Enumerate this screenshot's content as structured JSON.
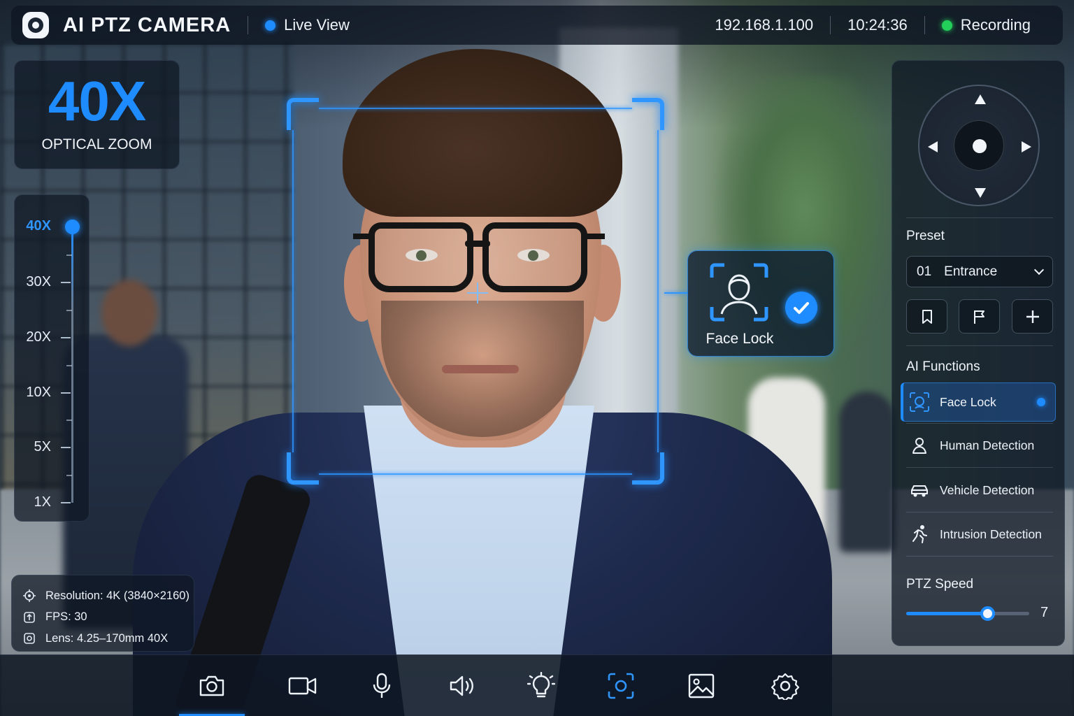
{
  "topbar": {
    "brand": "AI PTZ CAMERA",
    "live_view": "Live View",
    "ip": "192.168.1.100",
    "time": "10:24:36",
    "status": "Recording"
  },
  "zoom_card": {
    "value": "40X",
    "label": "OPTICAL ZOOM"
  },
  "zoom_scale": {
    "ticks": [
      "40X",
      "30X",
      "20X",
      "10X",
      "5X",
      "1X"
    ],
    "current": "40X"
  },
  "info": {
    "resolution": "Resolution: 4K (3840×2160)",
    "fps": "FPS: 30",
    "lens": "Lens: 4.25–170mm 40X"
  },
  "target": {
    "card_label": "Face Lock"
  },
  "right_panel": {
    "preset_title": "Preset",
    "preset_number": "01",
    "preset_name": "Entrance",
    "ai_title": "AI Functions",
    "ai_items": [
      {
        "label": "Face Lock",
        "icon": "face-scan-icon",
        "active": true
      },
      {
        "label": "Human Detection",
        "icon": "person-icon",
        "active": false
      },
      {
        "label": "Vehicle Detection",
        "icon": "car-icon",
        "active": false
      },
      {
        "label": "Intrusion Detection",
        "icon": "running-person-icon",
        "active": false
      }
    ],
    "speed_title": "PTZ Speed",
    "speed_value": "7",
    "speed_fraction": 0.66
  },
  "toolbar": {
    "items": [
      "camera-icon",
      "video-icon",
      "microphone-icon",
      "speaker-icon",
      "light-bulb-icon",
      "focus-scan-icon",
      "image-icon",
      "settings-icon"
    ],
    "active": "camera-icon"
  },
  "colors": {
    "accent": "#1e8cff",
    "recording": "#22d05a",
    "panel": "#0e1622"
  }
}
